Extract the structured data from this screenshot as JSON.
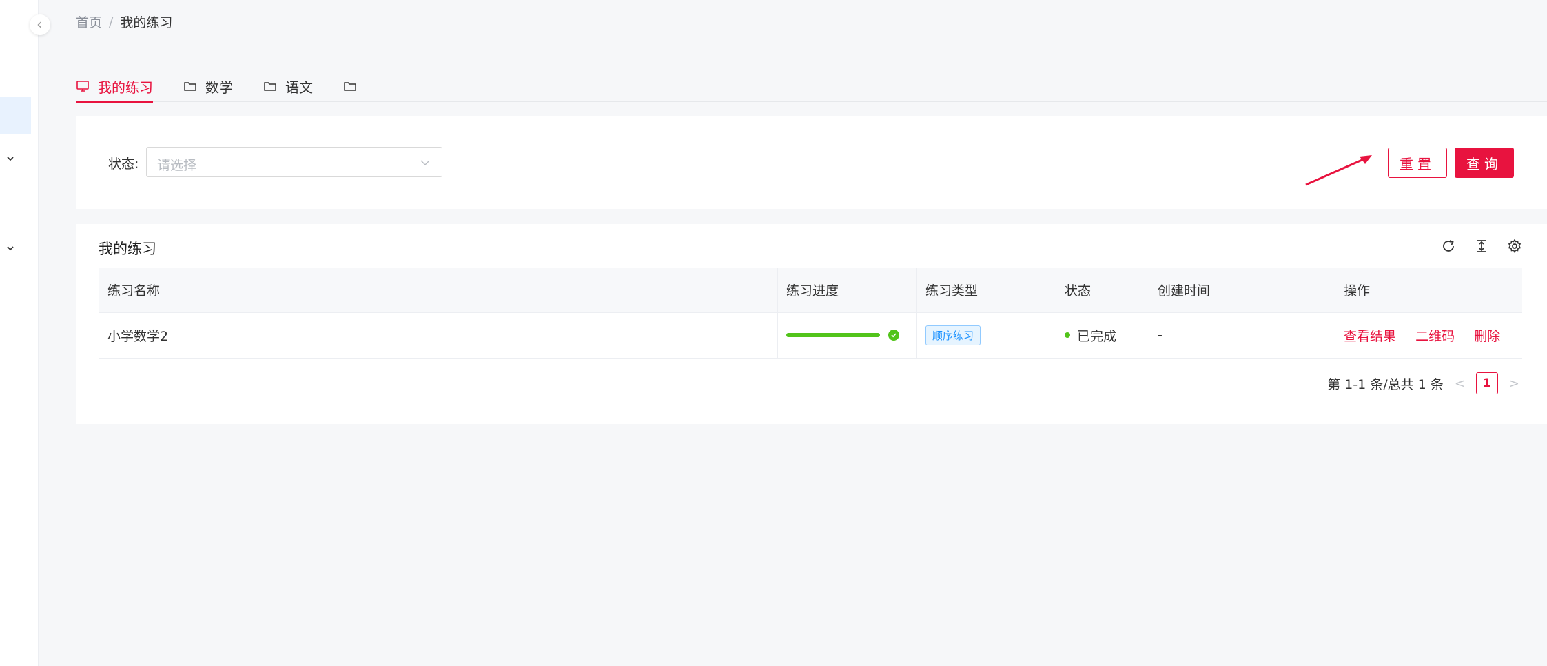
{
  "breadcrumb": {
    "home": "首页",
    "separator": "/",
    "current": "我的练习"
  },
  "tabs": [
    {
      "label": "我的练习",
      "icon": "desktop-icon",
      "active": true
    },
    {
      "label": "数学",
      "icon": "folder-icon",
      "active": false
    },
    {
      "label": "语文",
      "icon": "folder-icon",
      "active": false
    },
    {
      "label": "",
      "icon": "folder-icon",
      "active": false
    }
  ],
  "filter": {
    "status_label": "状态:",
    "status_placeholder": "请选择",
    "reset_label": "重置",
    "query_label": "查询"
  },
  "table": {
    "title": "我的练习",
    "toolbar": [
      "reload-icon",
      "density-icon",
      "settings-icon"
    ],
    "columns": [
      "练习名称",
      "练习进度",
      "练习类型",
      "状态",
      "创建时间",
      "操作"
    ],
    "rows": [
      {
        "name": "小学数学2",
        "progress": 100,
        "type": "顺序练习",
        "status": "已完成",
        "created": "-",
        "actions": [
          "查看结果",
          "二维码",
          "删除"
        ]
      }
    ]
  },
  "pagination": {
    "summary": "第 1-1 条/总共 1 条",
    "current_page": "1"
  },
  "colors": {
    "primary": "#e8133f",
    "success": "#52c41a",
    "tag_blue": "#1890ff"
  }
}
